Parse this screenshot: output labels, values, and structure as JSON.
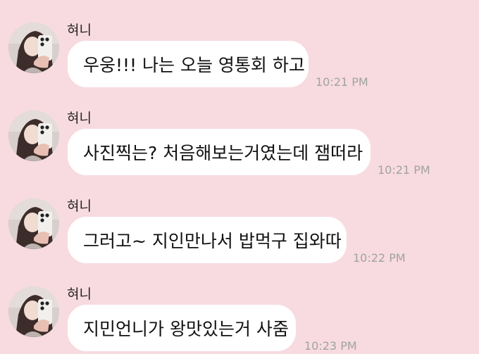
{
  "messages": [
    {
      "sender": "혀니",
      "text": "우웅!!! 나는 오늘 영통회 하고",
      "time": "10:21 PM"
    },
    {
      "sender": "혀니",
      "text": "사진찍는? 처음해보는거였는데 잼떠라",
      "time": "10:21 PM"
    },
    {
      "sender": "혀니",
      "text": "그러고~ 지인만나서 밥먹구 집와따",
      "time": "10:22 PM"
    },
    {
      "sender": "혀니",
      "text": "지민언니가 왕맛있는거 사줌",
      "time": "10:23 PM"
    }
  ],
  "colors": {
    "background": "#f7dbe0",
    "bubble": "#ffffff",
    "time": "#a2a2a2"
  }
}
